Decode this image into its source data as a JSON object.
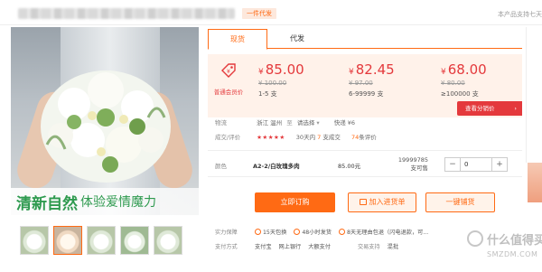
{
  "topbar": {
    "tag": "一件代发",
    "right_note": "本产品支持七天"
  },
  "product": {
    "promo_text_a": "清新自然",
    "promo_text_b": "体验爱情魔力",
    "thumbnail_count": 5
  },
  "tabs": [
    {
      "label": "现货",
      "active": true
    },
    {
      "label": "代发",
      "active": false
    }
  ],
  "pricing": {
    "badge_label": "普通会员价",
    "currency": "¥",
    "tiers": [
      {
        "price": "85.00",
        "old": "100.00",
        "range": "1-5 支"
      },
      {
        "price": "82.45",
        "old": "97.00",
        "range": "6-99999 支"
      },
      {
        "price": "68.00",
        "old": "80.00",
        "range": "≥100000 支"
      }
    ],
    "view_tier_button": "查看分销价"
  },
  "logistics": {
    "label": "物流",
    "origin": "浙江 温州",
    "to_label": "至",
    "destination": "请选择",
    "dropdown_icon": "chevron-down-icon",
    "express": "快递 ¥6"
  },
  "reviews": {
    "label": "成交/评价",
    "stars": "★★★★★",
    "deal_prefix": "30天内",
    "deal_count": "7",
    "deal_suffix": "支成交",
    "review_count": "74",
    "review_suffix": "条评价"
  },
  "spec": {
    "label": "颜色",
    "name": "A2-2/白玫瑰多肉",
    "price": "85.00元",
    "stock_number": "19999785",
    "stock_unit": "支可售",
    "minus": "−",
    "quantity": "0",
    "plus": "+"
  },
  "actions": {
    "buy": "立即订购",
    "cart": "加入进货单",
    "onekey": "一键铺货"
  },
  "guarantee": {
    "label": "实力保障",
    "items": [
      "15天包换",
      "48小时发货",
      "8天无理由包退（闪电退款，可..."
    ]
  },
  "payment": {
    "label": "支付方式",
    "methods": [
      "支付宝",
      "网上银行",
      "大额支付"
    ],
    "trade_label": "交易支持",
    "trade_value": "混批"
  },
  "watermark": {
    "text": "什么值得买",
    "sub": "SMZDM.COM"
  },
  "colors": {
    "accent": "#ff6a14",
    "price_red": "#e4393c",
    "price_bg": "#fff2ea"
  }
}
